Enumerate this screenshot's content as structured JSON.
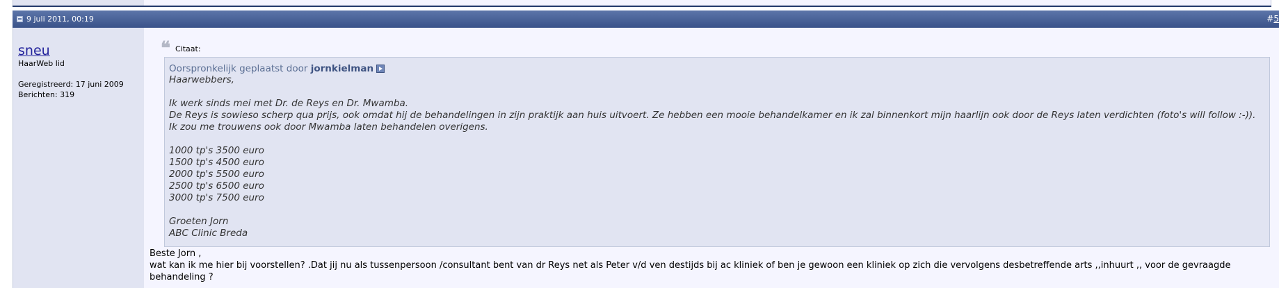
{
  "post": {
    "date": "9 juli 2011, 00:19",
    "number_prefix": "#",
    "number_link": "5"
  },
  "user": {
    "name": "sneu",
    "title": "HaarWeb lid",
    "registered": "Geregistreerd: 17 juni 2009",
    "posts": "Berichten: 319"
  },
  "quote": {
    "label": "Citaat:",
    "posted_by": "Oorspronkelijk geplaatst door",
    "author": "jornkielman",
    "lines": [
      "Haarwebbers,",
      "Ik werk sinds mei met Dr. de Reys en Dr. Mwamba.",
      "De Reys is sowieso scherp qua prijs, ook omdat hij de behandelingen in zijn praktijk aan huis uitvoert. Ze hebben een mooie behandelkamer en ik zal binnenkort mijn haarlijn ook door de Reys laten verdichten (foto's will follow :-)).",
      "Ik zou me trouwens ook door Mwamba laten behandelen overigens.",
      "1000 tp's 3500 euro",
      "1500 tp's 4500 euro",
      "2000 tp's 5500 euro",
      "2500 tp's 6500 euro",
      "3000 tp's 7500 euro",
      "Groeten Jorn",
      "ABC Clinic Breda"
    ]
  },
  "reply": {
    "lines": [
      "Beste Jorn ,",
      "wat kan ik me hier bij voorstellen? .Dat jij nu als tussenpersoon /consultant bent van dr Reys net als Peter v/d ven destijds bij ac kliniek of ben je gewoon een kliniek op zich die vervolgens desbetreffende arts ,,inhuurt ,, voor de gevraagde",
      "behandeling ?"
    ]
  },
  "icons": {
    "post_icon": "post-icon",
    "quote_mark": "quote-icon",
    "view_post": "view-post-icon"
  },
  "colors": {
    "header": "#3a5289",
    "user_column": "#e1e4f2",
    "message_bg": "#f5f5ff",
    "quote_bg": "#e1e4f2",
    "username_link": "#22229c"
  }
}
